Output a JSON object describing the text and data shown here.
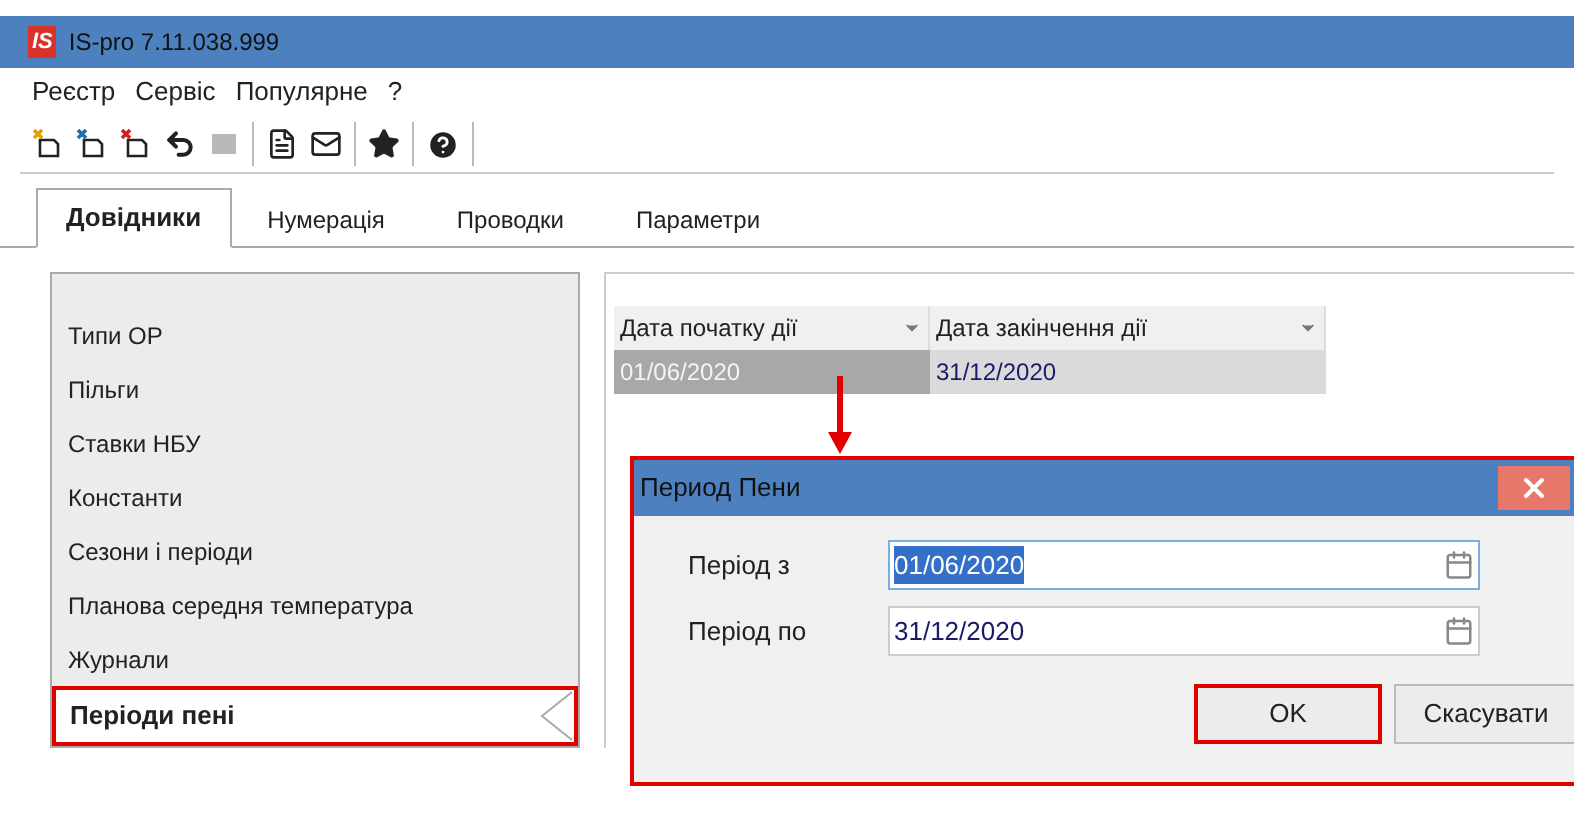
{
  "window": {
    "title": "IS-pro 7.11.038.999",
    "logo": "IS"
  },
  "menu": [
    "Реєстр",
    "Сервіс",
    "Популярне",
    "?"
  ],
  "tabs": [
    {
      "label": "Довідники",
      "selected": true
    },
    {
      "label": "Нумерація",
      "selected": false
    },
    {
      "label": "Проводки",
      "selected": false
    },
    {
      "label": "Параметри",
      "selected": false
    }
  ],
  "sidebar": {
    "items": [
      {
        "label": "Типи ОР",
        "selected": false
      },
      {
        "label": "Пільги",
        "selected": false
      },
      {
        "label": "Ставки НБУ",
        "selected": false
      },
      {
        "label": "Константи",
        "selected": false
      },
      {
        "label": "Сезони і періоди",
        "selected": false
      },
      {
        "label": "Планова середня температура",
        "selected": false
      },
      {
        "label": "Журнали",
        "selected": false
      },
      {
        "label": "Періоди пені",
        "selected": true
      }
    ]
  },
  "table": {
    "columns": [
      "Дата початку дії",
      "Дата закінчення дії"
    ],
    "rows": [
      {
        "cells": [
          "01/06/2020",
          "31/12/2020"
        ],
        "selected": true
      }
    ]
  },
  "dialog": {
    "title": "Период Пени",
    "fields": [
      {
        "label": "Період з",
        "value": "01/06/2020",
        "text_selected": true
      },
      {
        "label": "Період по",
        "value": "31/12/2020",
        "text_selected": false
      }
    ],
    "buttons": [
      {
        "label": "OK",
        "annotated": true
      },
      {
        "label": "Скасувати",
        "annotated": false
      }
    ]
  }
}
